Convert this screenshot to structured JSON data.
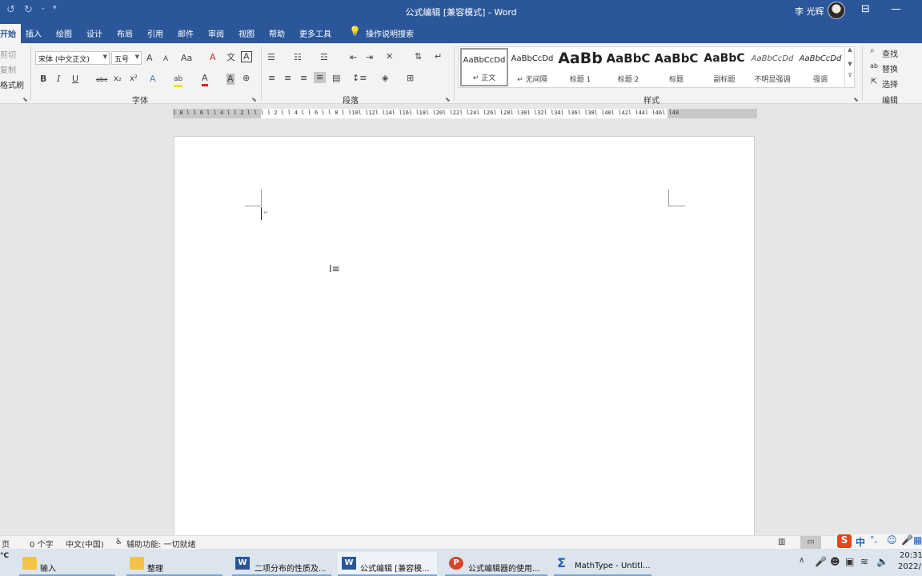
{
  "window": {
    "title": "公式编辑 [兼容模式] - Word",
    "user": "李 光辉",
    "qat_icons": [
      "redo-icon",
      "undo-icon",
      "customize-qat-icon"
    ]
  },
  "tabs": [
    "开始",
    "插入",
    "绘图",
    "设计",
    "布局",
    "引用",
    "邮件",
    "审阅",
    "视图",
    "帮助",
    "更多工具"
  ],
  "tell_me": "操作说明搜索",
  "clipboard": {
    "cut": "剪切",
    "copy": "复制",
    "format_painter": "格式刷"
  },
  "font": {
    "group_label": "字体",
    "name": "宋体 (中文正文)",
    "size": "五号",
    "grow": "A",
    "shrink": "A",
    "case": "Aa",
    "bold": "B",
    "italic": "I",
    "underline": "U",
    "strike": "abc",
    "sub": "x₂",
    "sup": "x²",
    "effects": "A",
    "highlight": "ab",
    "color": "A",
    "shading": "A"
  },
  "paragraph": {
    "group_label": "段落"
  },
  "styles": {
    "group_label": "样式",
    "items": [
      {
        "preview": "AaBbCcDd",
        "name": "↵ 正文"
      },
      {
        "preview": "AaBbCcDd",
        "name": "↵ 无间隔"
      },
      {
        "preview": "AaBb",
        "name": "标题 1"
      },
      {
        "preview": "AaBbC",
        "name": "标题 2"
      },
      {
        "preview": "AaBbC",
        "name": "标题"
      },
      {
        "preview": "AaBbC",
        "name": "副标题"
      },
      {
        "preview": "AaBbCcDd",
        "name": "不明显强调"
      },
      {
        "preview": "AaBbCcDd",
        "name": "强调"
      }
    ]
  },
  "editing": {
    "group_label": "编辑",
    "find": "查找",
    "replace": "替换",
    "select": "选择"
  },
  "ruler": "l 8 l  l 6 l  l 4 l  l 2 l  l   l  l 2 l  l 4 l  l 6 l  l 8 l  l10l  l12l  l14l  l16l  l18l  l20l  l22l  l24l  l26l  l28l  l30l  l32l  l34l  l36l  l38l  l40l  l42l  l44l  l46l  l48",
  "status": {
    "page": "页",
    "words": "0 个字",
    "language": "中文(中国)",
    "accessibility": "辅助功能: 一切就绪"
  },
  "taskbar": {
    "weather": "°C",
    "apps": [
      {
        "label": "输入",
        "icon": "folder-icon"
      },
      {
        "label": "整理",
        "icon": "folder-icon"
      },
      {
        "label": "二项分布的性质及...",
        "icon": "word-icon"
      },
      {
        "label": "公式编辑 [兼容模...",
        "icon": "word-icon"
      },
      {
        "label": "公式编辑器的使用...",
        "icon": "powerpoint-icon"
      },
      {
        "label": "MathType - Untitl...",
        "icon": "mathtype-icon"
      }
    ],
    "clock_time": "20:31",
    "clock_date": "2022/",
    "ime_lang": "中"
  }
}
